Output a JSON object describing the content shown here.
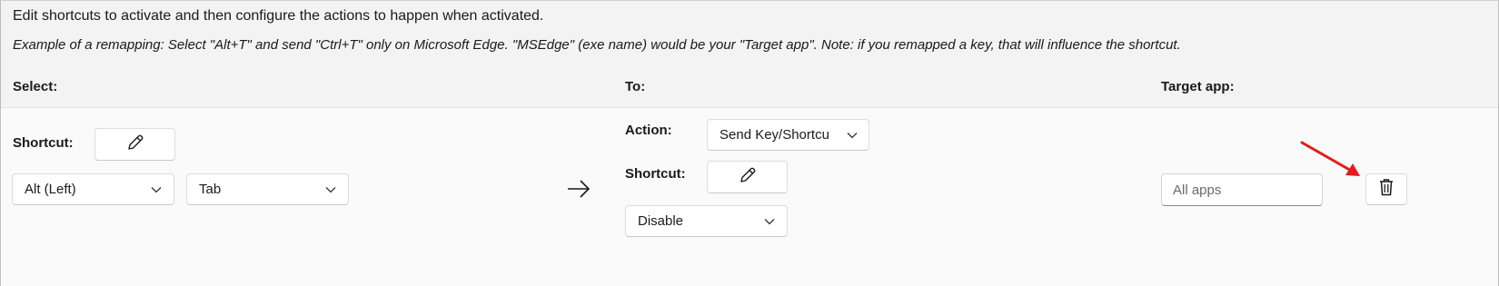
{
  "header": {
    "instruction": "Edit shortcuts to activate and then configure the actions to happen when activated.",
    "example": "Example of a remapping: Select \"Alt+T\" and send \"Ctrl+T\" only on Microsoft Edge. \"MSEdge\" (exe name) would be your \"Target app\". Note: if you remapped a key, that will influence the shortcut."
  },
  "columns": {
    "select": "Select:",
    "to": "To:",
    "target_app": "Target app:"
  },
  "row": {
    "select": {
      "shortcut_label": "Shortcut:",
      "edit_icon": "pencil-icon",
      "key1": "Alt (Left)",
      "key2": "Tab"
    },
    "arrow_icon": "right-arrow-icon",
    "to": {
      "action_label": "Action:",
      "action_value": "Send Key/Shortcu",
      "shortcut_label": "Shortcut:",
      "edit_icon": "pencil-icon",
      "key1": "Disable"
    },
    "target_app": {
      "placeholder": "All apps"
    },
    "delete_icon": "trash-icon"
  },
  "annotation": {
    "arrow_color": "#e31b1b"
  }
}
